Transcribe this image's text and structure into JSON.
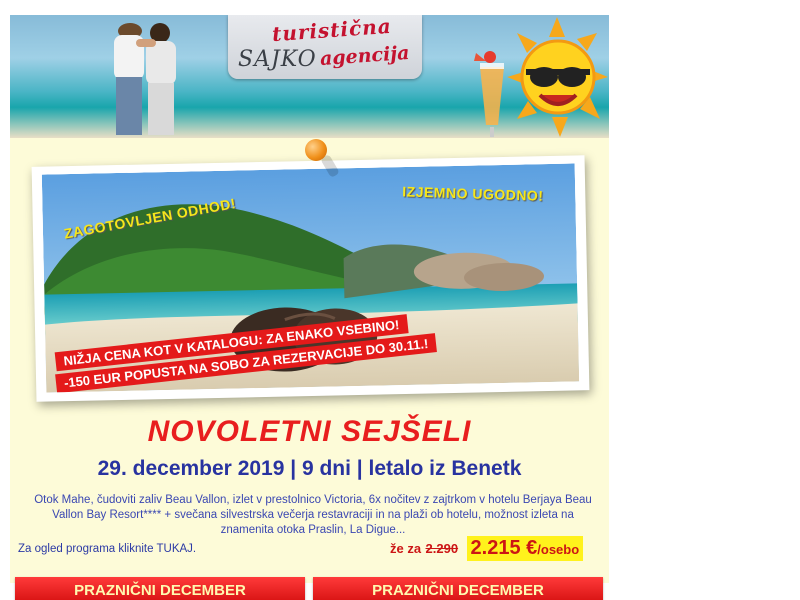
{
  "header": {
    "logo_line1": "turistična",
    "logo_sajko": "SAJKO",
    "logo_line2": "agencija"
  },
  "promo": {
    "badge_left": "ZAGOTOVLJEN ODHOD!",
    "badge_right": "IZJEMNO UGODNO!",
    "ribbon_line1": "NIŽJA CENA KOT V KATALOGU: ZA ENAKO VSEBINO!",
    "ribbon_line2": "-150 EUR POPUSTA NA SOBO ZA REZERVACIJE DO 30.11.!"
  },
  "offer": {
    "title": "NOVOLETNI SEJŠELI",
    "subtitle": "29. december 2019 | 9 dni | letalo iz Benetk",
    "description": "Otok Mahe, čudoviti zaliv Beau Vallon, izlet v prestolnico Victoria, 6x nočitev z zajtrkom v hotelu Berjaya Beau Vallon Bay Resort**** + svečana silvestrska večerja restavraciji in na plaži ob hotelu, možnost izleta na znamenita otoka Praslin, La Digue...",
    "program_link": "Za ogled programa kliknite TUKAJ.",
    "price_prefix": "že za",
    "price_old": "2.290",
    "price_new": "2.215 €",
    "price_unit": "/osebo"
  },
  "categories": [
    {
      "label": "PRAZNIČNI DECEMBER"
    },
    {
      "label": "PRAZNIČNI DECEMBER"
    }
  ],
  "colors": {
    "accent_red": "#e81e1e",
    "title_blue": "#2833a0",
    "highlight_yellow": "#fff21c",
    "body_bg": "#fdfbd8"
  }
}
